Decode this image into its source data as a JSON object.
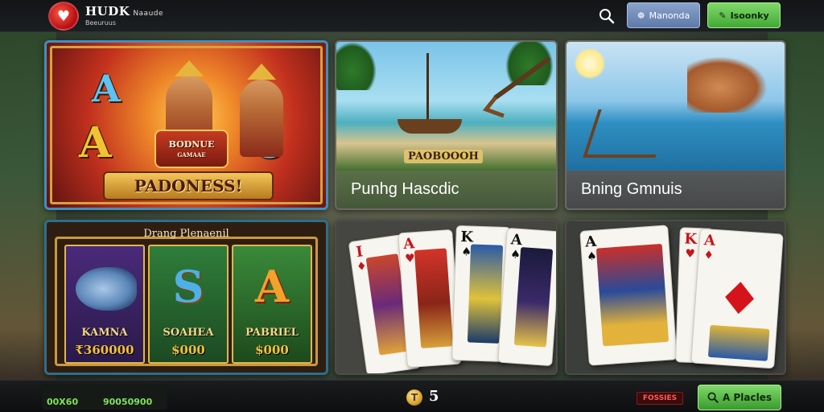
{
  "header": {
    "logo_mark": "♥",
    "title": "HUDK",
    "title_suffix": "Naaude",
    "subtitle": "Beeuruus",
    "login_label": "Manonda",
    "register_label": "Isoonky"
  },
  "games": [
    {
      "banner": "PADONESS!",
      "shield_line1": "BODNUE",
      "shield_line2": "GAMAAE",
      "letters": [
        "A",
        "A",
        "C"
      ]
    },
    {
      "caption": "PAOBOOOH",
      "label": "Punhg Hascdic"
    },
    {
      "label": "Bning Gmnuis"
    },
    {
      "header": "Drang Plenaenil",
      "reels": [
        {
          "name": "KAMNA",
          "value": "₹360000",
          "symbol": ""
        },
        {
          "name": "SOAHEA",
          "value": "$000",
          "symbol": "S"
        },
        {
          "name": "PABRIEL",
          "value": "$000",
          "symbol": "A"
        }
      ]
    },
    {
      "cards": [
        {
          "rank": "I",
          "suit": "♦"
        },
        {
          "rank": "A",
          "suit": "♥"
        },
        {
          "rank": "K",
          "suit": "♠"
        },
        {
          "rank": "A",
          "suit": "♠"
        }
      ]
    },
    {
      "cards": [
        {
          "rank": "A",
          "suit": "♠"
        },
        {
          "rank": "K",
          "suit": "♥"
        },
        {
          "rank": "A",
          "suit": "♦"
        }
      ]
    }
  ],
  "footer": {
    "balance_label_1": "",
    "balance_value_1": "00X60",
    "balance_label_2": "",
    "balance_value_2": "90050900",
    "coin_symbol": "T",
    "coin_value": "5",
    "promo_label": "FOSSIES",
    "play_label": "A Placles"
  },
  "colors": {
    "accent_green": "#42a836",
    "accent_blue": "#5e7aa8",
    "accent_gold": "#d6a23e"
  }
}
